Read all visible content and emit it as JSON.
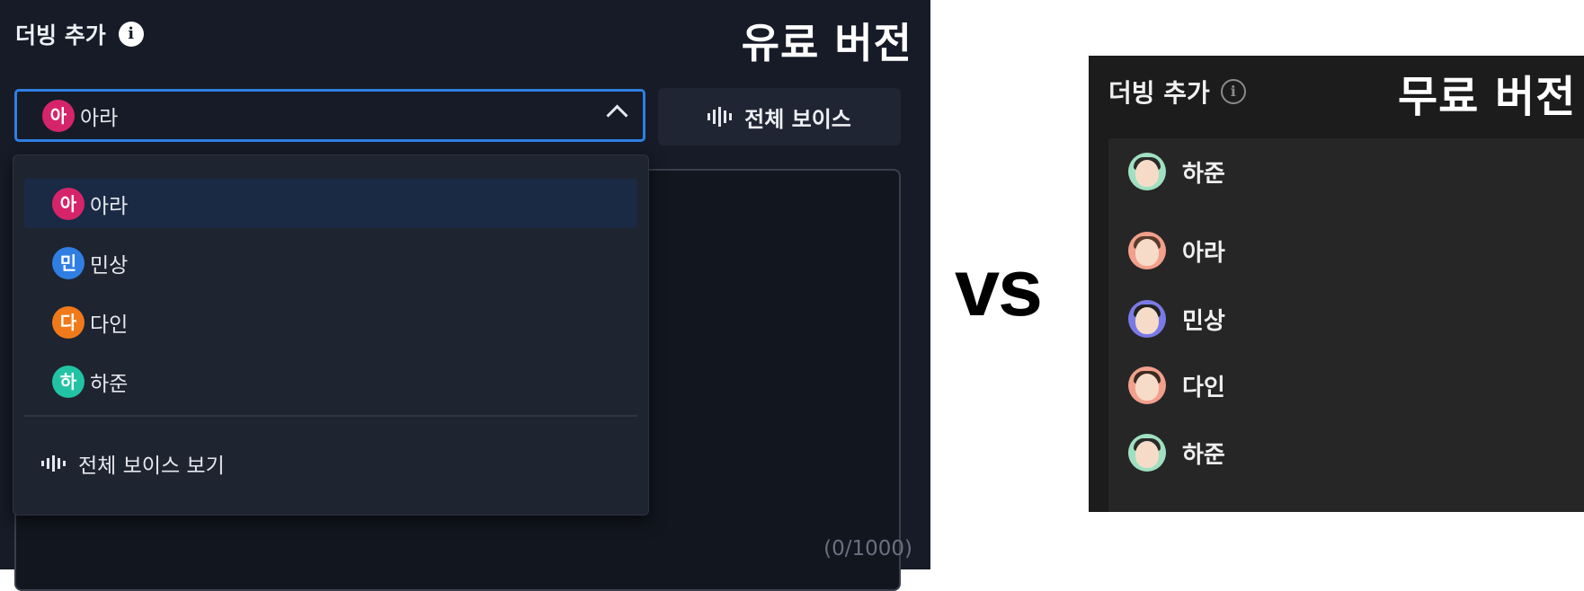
{
  "paid": {
    "title": "더빙 추가",
    "info_icon": "i",
    "version_label": "유료 버전",
    "selected": {
      "badge": "아",
      "name": "아라",
      "color": "#d6246b"
    },
    "all_voices_button": "전체 보이스",
    "options": [
      {
        "badge": "아",
        "name": "아라",
        "color": "#d6246b",
        "selected": true
      },
      {
        "badge": "민",
        "name": "민상",
        "color": "#2f7fe2",
        "selected": false
      },
      {
        "badge": "다",
        "name": "다인",
        "color": "#f07a1a",
        "selected": false
      },
      {
        "badge": "하",
        "name": "하준",
        "color": "#22c3a4",
        "selected": false
      }
    ],
    "view_all_voices": "전체 보이스 보기",
    "char_counter": "(0/1000)"
  },
  "vs_label": "vs",
  "free": {
    "title": "더빙 추가",
    "info_icon": "i",
    "version_label": "무료 버전",
    "selected": {
      "name": "하준",
      "avatar_color": "#9fe0c0"
    },
    "options": [
      {
        "name": "아라",
        "avatar_color": "#f2a08c"
      },
      {
        "name": "민상",
        "avatar_color": "#7a7ae6"
      },
      {
        "name": "다인",
        "avatar_color": "#f2a08c"
      },
      {
        "name": "하준",
        "avatar_color": "#9fe0c0"
      }
    ]
  }
}
